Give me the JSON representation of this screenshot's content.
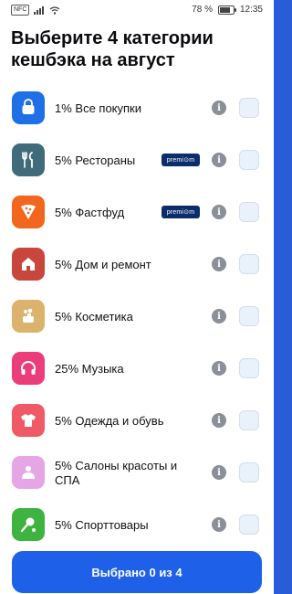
{
  "statusbar": {
    "left_badge": "NFC",
    "battery_text": "78 %",
    "battery_level": 0.78,
    "time": "12:35"
  },
  "title": "Выберите 4 категории кешбэка на август",
  "colors": {
    "accent": "#1e61e8",
    "premium_badge": "#0b2d6b",
    "checkbox_bg": "#e9f1fb",
    "info_icon": "#8a8f98"
  },
  "categories": [
    {
      "label": "1% Все покупки",
      "icon": "shopping-bag-icon",
      "color": "#1f6fe6",
      "premium": false
    },
    {
      "label": "5% Рестораны",
      "icon": "fork-knife-icon",
      "color": "#3f6b7a",
      "premium": true
    },
    {
      "label": "5% Фастфуд",
      "icon": "pizza-icon",
      "color": "#f2661d",
      "premium": true
    },
    {
      "label": "5% Дом и ремонт",
      "icon": "house-icon",
      "color": "#c9463d",
      "premium": false
    },
    {
      "label": "5% Косметика",
      "icon": "cosmetics-icon",
      "color": "#dbb36d",
      "premium": false
    },
    {
      "label": "25% Музыка",
      "icon": "headphones-icon",
      "color": "#ea3d7a",
      "premium": false
    },
    {
      "label": "5% Одежда и обувь",
      "icon": "tshirt-icon",
      "color": "#ef5a66",
      "premium": false
    },
    {
      "label": "5% Салоны красоты и СПА",
      "icon": "beauty-salon-icon",
      "color": "#e6a6e6",
      "premium": false
    },
    {
      "label": "5% Спорттовары",
      "icon": "sports-icon",
      "color": "#3fb33f",
      "premium": false
    }
  ],
  "premium_label": "premi⊙m",
  "info_glyph": "i",
  "cta": {
    "label": "Выбрано 0 из 4"
  }
}
